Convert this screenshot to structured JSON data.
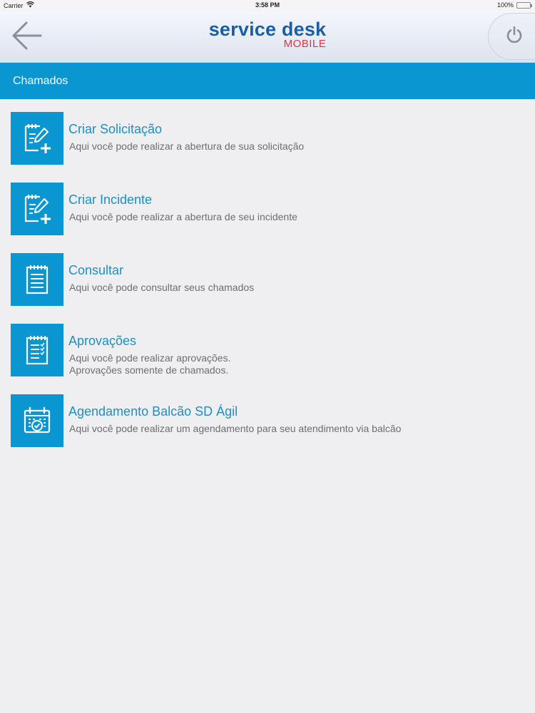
{
  "status_bar": {
    "carrier": "Carrier",
    "time": "3:58 PM",
    "battery": "100%"
  },
  "header": {
    "back_icon": "arrow-left-icon",
    "logo_main": "service desk",
    "logo_sub": "MOBILE",
    "power_icon": "power-icon"
  },
  "section": {
    "title": "Chamados"
  },
  "menu": {
    "items": [
      {
        "icon": "edit-add-document-icon",
        "title": "Criar Solicitação",
        "desc": "Aqui você pode realizar a abertura de sua solicitação",
        "desc2": ""
      },
      {
        "icon": "edit-add-document-icon",
        "title": "Criar Incidente",
        "desc": "Aqui você pode realizar a abertura de seu incidente",
        "desc2": ""
      },
      {
        "icon": "document-list-icon",
        "title": "Consultar",
        "desc": "Aqui você pode consultar seus chamados",
        "desc2": ""
      },
      {
        "icon": "document-checklist-icon",
        "title": "Aprovações",
        "desc": "Aqui você pode realizar aprovações.",
        "desc2": "Aprovações somente de chamados."
      },
      {
        "icon": "calendar-check-icon",
        "title": "Agendamento Balcão SD Ágil",
        "desc": "Aqui você pode realizar um agendamento para seu atendimento via balcão",
        "desc2": ""
      }
    ]
  },
  "colors": {
    "accent": "#0a97d1",
    "title_text": "#1c8fc4",
    "logo_blue": "#1a5fa5",
    "logo_red": "#d13a4a",
    "background": "#efeff2"
  }
}
